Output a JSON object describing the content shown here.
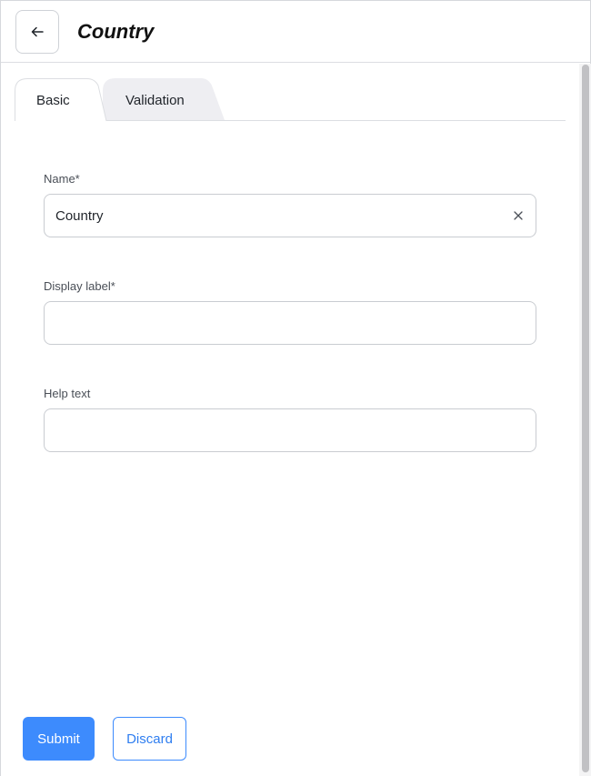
{
  "header": {
    "back_icon": "arrow-left-icon",
    "title": "Country"
  },
  "tabs": [
    {
      "label": "Basic",
      "active": true
    },
    {
      "label": "Validation",
      "active": false
    }
  ],
  "form": {
    "name": {
      "label": "Name*",
      "value": "Country",
      "clear_icon": "close-icon"
    },
    "display_label": {
      "label": "Display label*",
      "value": ""
    },
    "help_text": {
      "label": "Help text",
      "value": ""
    }
  },
  "actions": {
    "submit_label": "Submit",
    "discard_label": "Discard"
  },
  "colors": {
    "primary": "#3d8bfd",
    "inactive_tab": "#eeeef2",
    "border": "#c9ccd1"
  }
}
